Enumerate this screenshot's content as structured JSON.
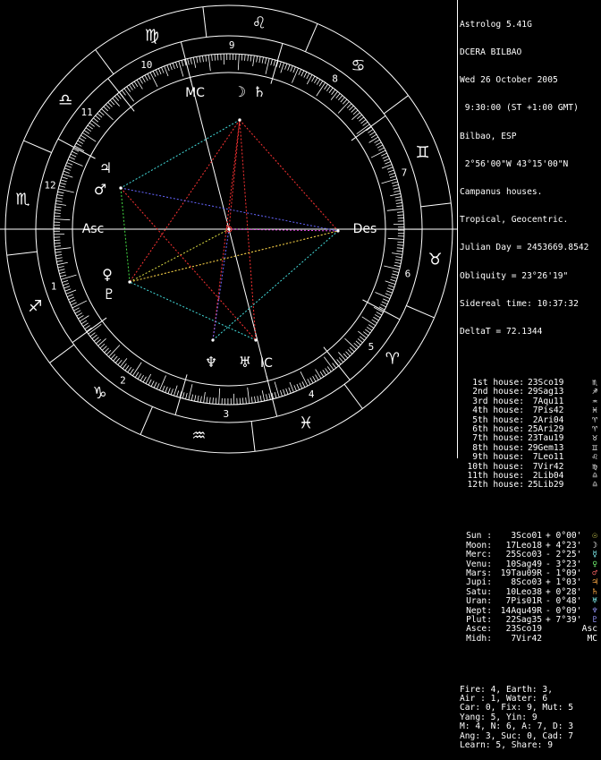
{
  "app": {
    "name": "Astrolog 5.41G",
    "chart_name": "DCERA BILBAO",
    "date": "Wed 26 October 2005",
    "time": " 9:30:00 (ST +1:00 GMT)",
    "place": "Bilbao, ESP",
    "coords": " 2°56'00\"W 43°15'00\"N",
    "house_system": "Campanus houses.",
    "zodiac": "Tropical, Geocentric.",
    "julian_day": "Julian Day = 2453669.8542",
    "obliquity": "Obliquity = 23°26'19\"",
    "sidereal": "Sidereal time: 10:37:32",
    "deltat": "DeltaT = 72.1344"
  },
  "houses": [
    {
      "label": "1st house:",
      "pos": "23Sco19",
      "glyph": "♏"
    },
    {
      "label": "2nd house:",
      "pos": "29Sag13",
      "glyph": "♐"
    },
    {
      "label": "3rd house:",
      "pos": " 7Aqu11",
      "glyph": "♒"
    },
    {
      "label": "4th house:",
      "pos": " 7Pis42",
      "glyph": "♓"
    },
    {
      "label": "5th house:",
      "pos": " 2Ari04",
      "glyph": "♈"
    },
    {
      "label": "6th house:",
      "pos": "25Ari29",
      "glyph": "♈"
    },
    {
      "label": "7th house:",
      "pos": "23Tau19",
      "glyph": "♉"
    },
    {
      "label": "8th house:",
      "pos": "29Gem13",
      "glyph": "♊"
    },
    {
      "label": "9th house:",
      "pos": " 7Leo11",
      "glyph": "♌"
    },
    {
      "label": "10th house:",
      "pos": " 7Vir42",
      "glyph": "♍"
    },
    {
      "label": "11th house:",
      "pos": " 2Lib04",
      "glyph": "♎"
    },
    {
      "label": "12th house:",
      "pos": "25Lib29",
      "glyph": "♎"
    }
  ],
  "planets": [
    {
      "label": "Sun :",
      "pos": " 3Sco01",
      "dec": "+ 0°00'",
      "glyph": "☉",
      "color": "#ff6"
    },
    {
      "label": "Moon:",
      "pos": "17Leo18",
      "dec": "+ 4°23'",
      "glyph": "☽",
      "color": "#fff"
    },
    {
      "label": "Merc:",
      "pos": "25Sco03",
      "dec": "- 2°25'",
      "glyph": "☿",
      "color": "#8ff"
    },
    {
      "label": "Venu:",
      "pos": "10Sag49",
      "dec": "- 3°23'",
      "glyph": "♀",
      "color": "#7f7"
    },
    {
      "label": "Mars:",
      "pos": "19Tau09R",
      "dec": "- 1°09'",
      "glyph": "♂",
      "color": "#f66"
    },
    {
      "label": "Jupi:",
      "pos": " 8Sco03",
      "dec": "+ 1°03'",
      "glyph": "♃",
      "color": "#fa4"
    },
    {
      "label": "Satu:",
      "pos": "10Leo38",
      "dec": "+ 0°28'",
      "glyph": "♄",
      "color": "#fa4"
    },
    {
      "label": "Uran:",
      "pos": " 7Pis01R",
      "dec": "- 0°48'",
      "glyph": "♅",
      "color": "#8ff"
    },
    {
      "label": "Nept:",
      "pos": "14Aqu49R",
      "dec": "- 0°09'",
      "glyph": "♆",
      "color": "#99f"
    },
    {
      "label": "Plut:",
      "pos": "22Sag35",
      "dec": "+ 7°39'",
      "glyph": "♇",
      "color": "#99f"
    },
    {
      "label": "Asce:",
      "pos": "23Sco19",
      "dec": "",
      "glyph": "Asc",
      "color": "#fff"
    },
    {
      "label": "Midh:",
      "pos": " 7Vir42",
      "dec": "",
      "glyph": "MC",
      "color": "#fff"
    }
  ],
  "stats": [
    "Fire: 4, Earth: 3,",
    "Air : 1, Water: 6",
    "Car: 0, Fix: 9, Mut: 5",
    "Yang: 5, Yin: 9",
    "M: 4, N: 6, A: 7, D: 3",
    "Ang: 3, Suc: 0, Cad: 7",
    "Learn: 5, Share: 9"
  ],
  "wheel": {
    "signs": [
      "♈",
      "♉",
      "♊",
      "♋",
      "♌",
      "♍",
      "♎",
      "♏",
      "♐",
      "♑",
      "♒",
      "♓"
    ],
    "house_numbers": [
      "1",
      "2",
      "3",
      "4",
      "5",
      "6",
      "7",
      "8",
      "9",
      "10",
      "11",
      "12"
    ],
    "axis_labels": {
      "asc": "Asc",
      "des": "Des",
      "mc": "MC",
      "ic": "IC"
    },
    "colors": {
      "line": "#ffffff",
      "red": "#ff3333",
      "cyan": "#44dddd",
      "yellow": "#dddd44",
      "green": "#44dd44",
      "blue": "#6666ff",
      "magenta": "#dd44dd"
    }
  }
}
